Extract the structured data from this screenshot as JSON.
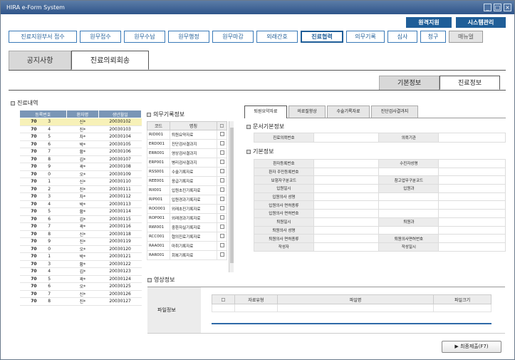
{
  "window": {
    "title": "HIRA e-Form System",
    "controls": [
      "_",
      "□",
      "×"
    ]
  },
  "top_buttons": [
    "원격지원",
    "시스템관리"
  ],
  "menu": [
    {
      "label": "진료지원부서 접수",
      "state": "normal"
    },
    {
      "label": "원무접수",
      "state": "normal"
    },
    {
      "label": "원무수납",
      "state": "normal"
    },
    {
      "label": "원무행정",
      "state": "normal"
    },
    {
      "label": "원무마감",
      "state": "normal"
    },
    {
      "label": "외래간호",
      "state": "normal"
    },
    {
      "label": "진료협력",
      "state": "active"
    },
    {
      "label": "의무기록",
      "state": "normal"
    },
    {
      "label": "심사",
      "state": "normal"
    },
    {
      "label": "청구",
      "state": "normal"
    },
    {
      "label": "매뉴얼",
      "state": "gray"
    }
  ],
  "main_tabs": [
    "공지사항",
    "진료의뢰회송"
  ],
  "sub_tabs": [
    "기본정보",
    "진료정보"
  ],
  "patients": {
    "section_title": "진료내역",
    "headers": [
      "등록번호",
      "환자명",
      "생년월일"
    ],
    "rows": [
      [
        "70",
        "3",
        "신*",
        "20030102"
      ],
      [
        "70",
        "4",
        "진*",
        "20030103"
      ],
      [
        "70",
        "5",
        "차*",
        "20030104"
      ],
      [
        "70",
        "6",
        "박*",
        "20030105"
      ],
      [
        "70",
        "7",
        "황*",
        "20030106"
      ],
      [
        "70",
        "8",
        "김*",
        "20030107"
      ],
      [
        "70",
        "9",
        "곽*",
        "20030108"
      ],
      [
        "70",
        "0",
        "오*",
        "20030109"
      ],
      [
        "70",
        "1",
        "신*",
        "20030110"
      ],
      [
        "70",
        "2",
        "진*",
        "20030111"
      ],
      [
        "70",
        "3",
        "차*",
        "20030112"
      ],
      [
        "70",
        "4",
        "박*",
        "20030113"
      ],
      [
        "70",
        "5",
        "황*",
        "20030114"
      ],
      [
        "70",
        "6",
        "김*",
        "20030115"
      ],
      [
        "70",
        "7",
        "곽*",
        "20030116"
      ],
      [
        "70",
        "8",
        "신*",
        "20030118"
      ],
      [
        "70",
        "9",
        "진*",
        "20030119"
      ],
      [
        "70",
        "0",
        "오*",
        "20030120"
      ],
      [
        "70",
        "1",
        "박*",
        "20030121"
      ],
      [
        "70",
        "3",
        "황*",
        "20030122"
      ],
      [
        "70",
        "4",
        "김*",
        "20030123"
      ],
      [
        "70",
        "5",
        "곽*",
        "20030124"
      ],
      [
        "70",
        "6",
        "오*",
        "20030125"
      ],
      [
        "70",
        "7",
        "신*",
        "20030126"
      ],
      [
        "70",
        "8",
        "진*",
        "20030127"
      ]
    ]
  },
  "records": {
    "section_title": "의무기록정보",
    "headers": [
      "코드",
      "명칭",
      "□"
    ],
    "rows": [
      [
        "RID001",
        "퇴원요약자료"
      ],
      [
        "ERD001",
        "진단검사결과지"
      ],
      [
        "ERR001",
        "영상검사결과지"
      ],
      [
        "ERP001",
        "병리검사결과지"
      ],
      [
        "RSS001",
        "수술기록자료"
      ],
      [
        "REE001",
        "응급기록자료"
      ],
      [
        "RII001",
        "입원초진기록자료"
      ],
      [
        "RIP001",
        "입원경과기록자료"
      ],
      [
        "ROO001",
        "외래초진기록자료"
      ],
      [
        "ROP001",
        "외래경과기록자료"
      ],
      [
        "RWI001",
        "중환자실기록자료"
      ],
      [
        "RCC001",
        "협의진료기록자료"
      ],
      [
        "RAA001",
        "마취기록자료"
      ],
      [
        "RAR001",
        "회복기록자료"
      ]
    ]
  },
  "detail_tabs": [
    "퇴원요약자료",
    "의료질향상",
    "수술기록자료",
    "진단검사결과지"
  ],
  "doc_info": {
    "section_title": "문서기본정보",
    "labels": [
      "진료의뢰번호",
      "의뢰기관"
    ]
  },
  "basic_info": {
    "section_title": "기본정보",
    "rows": [
      [
        "환자등록번호",
        "수진자성명"
      ],
      [
        "환자 주민등록번호",
        ""
      ],
      [
        "보험자구분코드",
        "참고업무구분코드"
      ],
      [
        "입원일시",
        "입원과"
      ],
      [
        "입원의사 성명",
        ""
      ],
      [
        "입원의사 면허종류",
        ""
      ],
      [
        "입원의사 면허번호",
        ""
      ],
      [
        "퇴원일시",
        "퇴원과"
      ],
      [
        "퇴원의사 성명",
        ""
      ],
      [
        "퇴원의사 면허종류",
        "퇴원의사면허번호"
      ],
      [
        "작성자",
        "작성일시"
      ]
    ]
  },
  "image_info": {
    "section_title": "영상정보",
    "label": "파일정보",
    "headers": [
      "□",
      "자료유형",
      "파일명",
      "파일크기"
    ]
  },
  "submit": {
    "icon": "▶",
    "label": "최종제출(F7)"
  },
  "colors": {
    "primary": "#1f5e98",
    "header": "#7a96b6",
    "selected_row": "#f7f1b8"
  }
}
